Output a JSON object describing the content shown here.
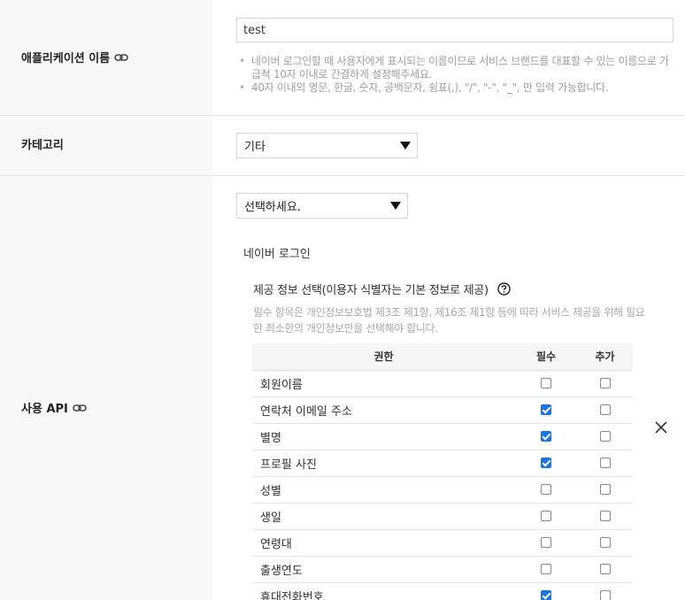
{
  "app_name": {
    "label": "애플리케이션 이름",
    "link_icon": "link-icon",
    "value": "test",
    "hints": [
      "네이버 로그인할 때 사용자에게 표시되는 이름이므로 서비스 브랜드를 대표할 수 있는 이름으로 가급적 10자 이내로 간결하게 설정해주세요.",
      "40자 이내의 영문, 한글, 숫자, 공백문자, 쉼표(,), \"/\", \"-\", \"_\", 만 입력 가능합니다."
    ]
  },
  "category": {
    "label": "카테고리",
    "selected": "기타"
  },
  "api": {
    "label": "사용 API",
    "link_icon": "link-icon",
    "select_placeholder": "선택하세요.",
    "api_name": "네이버 로그인",
    "info_title": "제공 정보 선택(이용자 식별자는 기본 정보로 제공)",
    "help_icon": "question-circle-icon",
    "info_desc": "필수 항목은 개인정보보호법 제3조 제1항, 제16조 제1항 등에 따라 서비스 제공을 위해 필요한 최소한의 개인정보만을 선택해야 합니다.",
    "close_icon": "close-icon",
    "table": {
      "headers": [
        "권한",
        "필수",
        "추가"
      ],
      "rows": [
        {
          "name": "회원이름",
          "required": false,
          "optional": false
        },
        {
          "name": "연락처 이메일 주소",
          "required": true,
          "optional": false
        },
        {
          "name": "별명",
          "required": true,
          "optional": false
        },
        {
          "name": "프로필 사진",
          "required": true,
          "optional": false
        },
        {
          "name": "성별",
          "required": false,
          "optional": false
        },
        {
          "name": "생일",
          "required": false,
          "optional": false
        },
        {
          "name": "연령대",
          "required": false,
          "optional": false
        },
        {
          "name": "출생연도",
          "required": false,
          "optional": false
        },
        {
          "name": "휴대전화번호",
          "required": true,
          "optional": false
        }
      ]
    }
  },
  "colors": {
    "label_bg": "#f8f8f8",
    "checkbox_checked": "#1a73e8"
  }
}
